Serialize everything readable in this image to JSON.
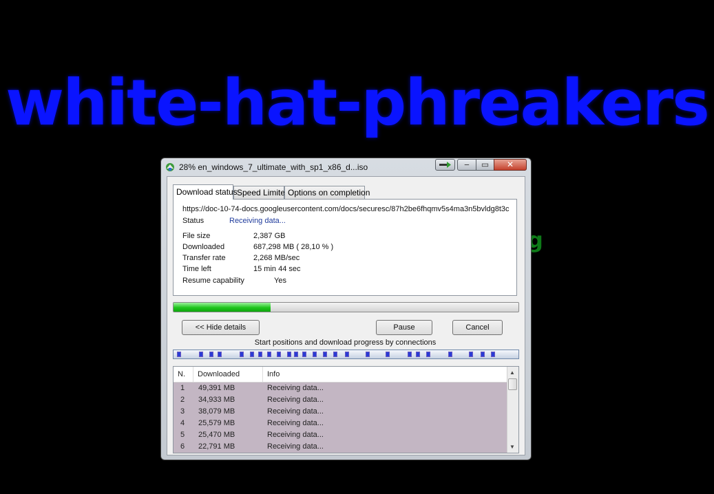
{
  "background": {
    "headline": "white-hat-phreakers",
    "fragment": "g"
  },
  "window": {
    "title": "28% en_windows_7_ultimate_with_sp1_x86_d...iso",
    "controls": {
      "minimize": "‒",
      "maximize": "▭",
      "close": "✕"
    }
  },
  "tabs": [
    {
      "label": "Download status",
      "active": true
    },
    {
      "label": "Speed Limiter",
      "active": false
    },
    {
      "label": "Options on completion",
      "active": false
    }
  ],
  "details": {
    "url": "https://doc-10-74-docs.googleusercontent.com/docs/securesc/87h2be6fhqmv5s4ma3n5bvldg8t3c",
    "status_label": "Status",
    "status_value": "Receiving data...",
    "file_size_label": "File size",
    "file_size_value": "2,387  GB",
    "downloaded_label": "Downloaded",
    "downloaded_value": "687,298  MB  ( 28,10 % )",
    "transfer_rate_label": "Transfer rate",
    "transfer_rate_value": "2,268  MB/sec",
    "time_left_label": "Time left",
    "time_left_value": "15 min 44 sec",
    "resume_label": "Resume capability",
    "resume_value": "Yes"
  },
  "progress": {
    "fraction": 0.281
  },
  "buttons": {
    "hide_details": "<< Hide details",
    "pause": "Pause",
    "cancel": "Cancel"
  },
  "connections": {
    "caption": "Start positions and download progress by connections",
    "color": "#2a3bd4",
    "start_fractions": [
      0.01,
      0.075,
      0.105,
      0.13,
      0.195,
      0.225,
      0.25,
      0.275,
      0.305,
      0.335,
      0.355,
      0.38,
      0.41,
      0.44,
      0.47,
      0.505,
      0.565,
      0.625,
      0.69,
      0.715,
      0.745,
      0.81,
      0.87,
      0.905,
      0.935
    ]
  },
  "connection_list": {
    "columns": [
      "N.",
      "Downloaded",
      "Info"
    ],
    "rows": [
      {
        "n": "1",
        "downloaded": "49,391  MB",
        "info": "Receiving data..."
      },
      {
        "n": "2",
        "downloaded": "34,933  MB",
        "info": "Receiving data..."
      },
      {
        "n": "3",
        "downloaded": "38,079  MB",
        "info": "Receiving data..."
      },
      {
        "n": "4",
        "downloaded": "25,579  MB",
        "info": "Receiving data..."
      },
      {
        "n": "5",
        "downloaded": "25,470  MB",
        "info": "Receiving data..."
      },
      {
        "n": "6",
        "downloaded": "22,791  MB",
        "info": "Receiving data..."
      }
    ],
    "row_color": "#c3b6c3"
  }
}
